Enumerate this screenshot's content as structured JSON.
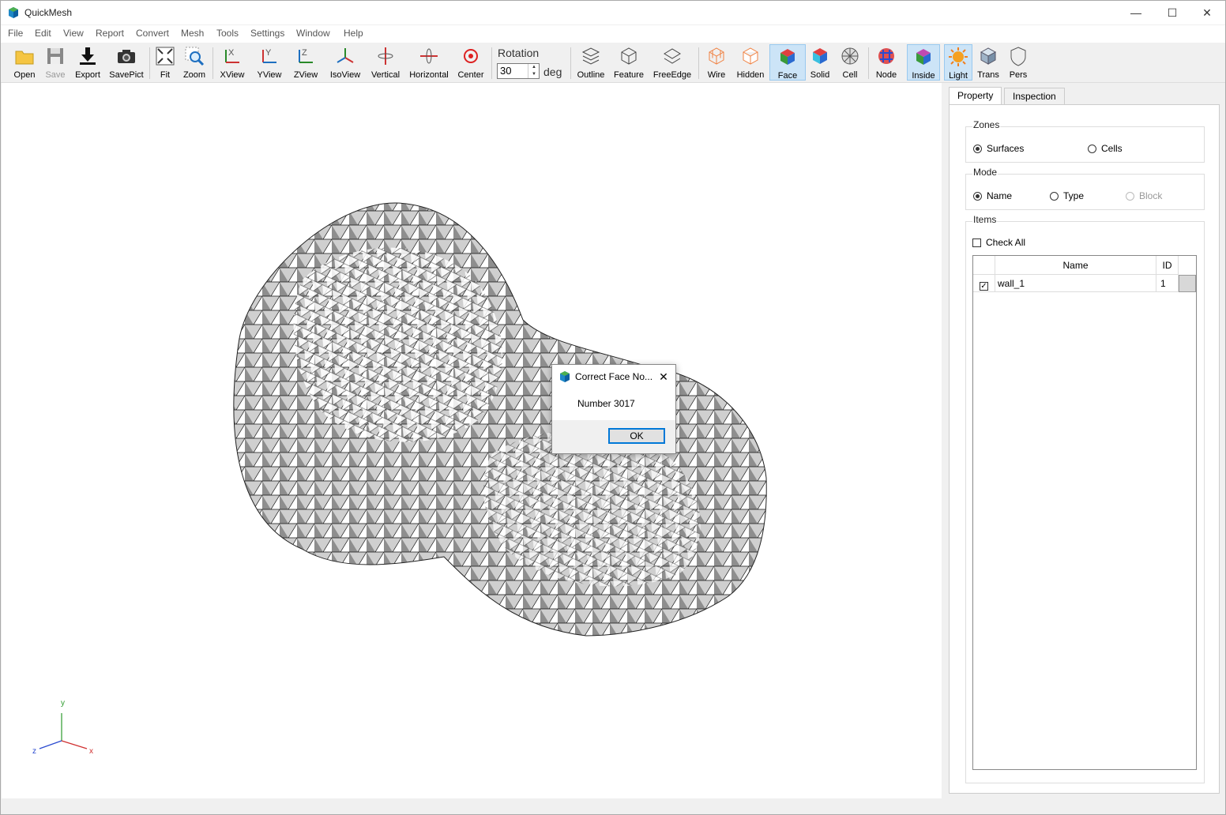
{
  "app": {
    "title": "QuickMesh"
  },
  "menu": [
    "File",
    "Edit",
    "View",
    "Report",
    "Convert",
    "Mesh",
    "Tools",
    "Settings",
    "Window",
    "Help"
  ],
  "toolbar": {
    "open": "Open",
    "save": "Save",
    "export": "Export",
    "savepict": "SavePict",
    "fit": "Fit",
    "zoom": "Zoom",
    "xview": "XView",
    "yview": "YView",
    "zview": "ZView",
    "isoview": "IsoView",
    "vertical": "Vertical",
    "horizontal": "Horizontal",
    "center": "Center",
    "rotation_label": "Rotation",
    "rotation_value": "30",
    "rotation_unit": "deg",
    "outline": "Outline",
    "feature": "Feature",
    "freeedge": "FreeEdge",
    "wire": "Wire",
    "hidden": "Hidden",
    "face": "Face",
    "solid": "Solid",
    "cell": "Cell",
    "node": "Node",
    "inside": "Inside",
    "light": "Light",
    "trans": "Trans",
    "pers": "Pers"
  },
  "axes": {
    "y": "y",
    "x": "x",
    "z": "z"
  },
  "panel": {
    "tabs": [
      "Property",
      "Inspection"
    ],
    "zones": {
      "title": "Zones",
      "options": [
        "Surfaces",
        "Cells"
      ],
      "selected": "Surfaces"
    },
    "mode": {
      "title": "Mode",
      "options": [
        "Name",
        "Type",
        "Block"
      ],
      "selected": "Name"
    },
    "items": {
      "title": "Items",
      "check_all": "Check All",
      "columns": [
        "Name",
        "ID"
      ],
      "rows": [
        {
          "name": "wall_1",
          "id": "1",
          "checked": true
        }
      ]
    }
  },
  "dialog": {
    "title": "Correct Face No...",
    "message": "Number 3017",
    "ok": "OK"
  }
}
